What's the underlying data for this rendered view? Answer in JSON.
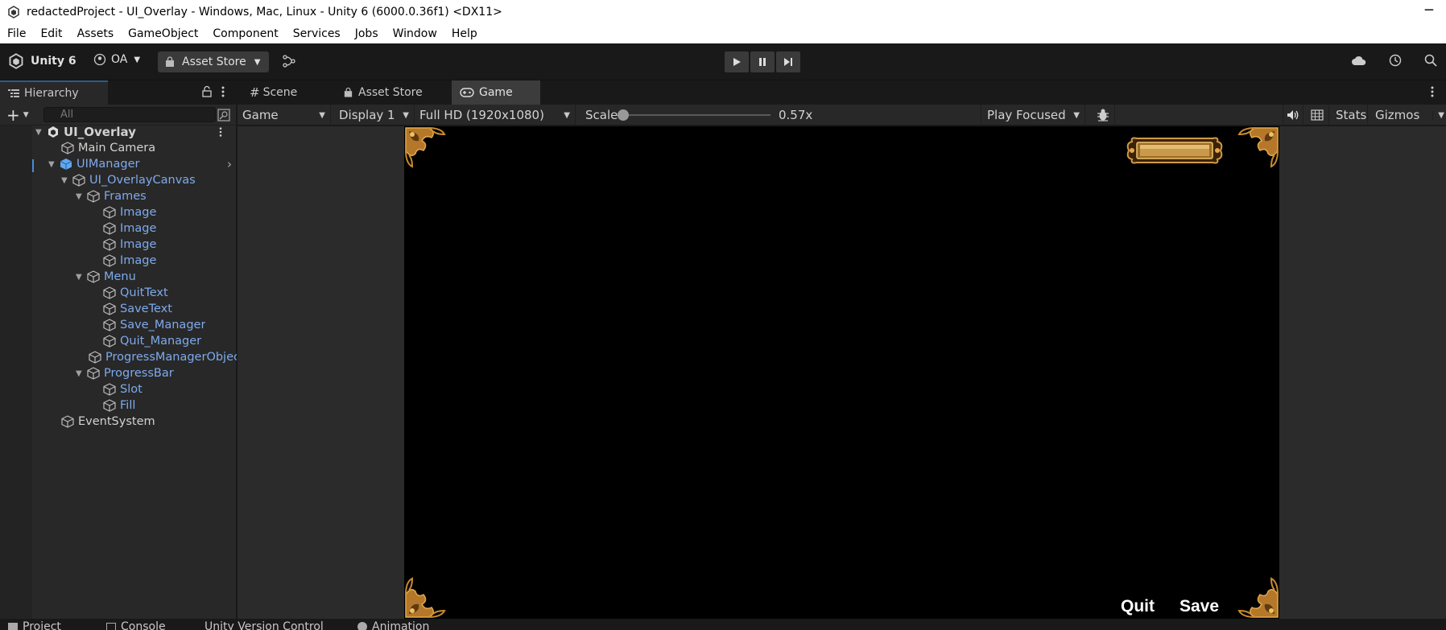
{
  "window": {
    "title": "redactedProject - UI_Overlay - Windows, Mac, Linux - Unity 6 (6000.0.36f1) <DX11>",
    "minimize": "─"
  },
  "menu": [
    "File",
    "Edit",
    "Assets",
    "GameObject",
    "Component",
    "Services",
    "Jobs",
    "Window",
    "Help"
  ],
  "toolbar": {
    "unity_label": "Unity 6",
    "account_label": "OA",
    "store_label": "Asset Store"
  },
  "tabs": {
    "hierarchy": "Hierarchy",
    "scene": "Scene",
    "asset_store": "Asset Store",
    "game": "Game"
  },
  "hierarchy": {
    "search_placeholder": "All",
    "items": [
      {
        "label": "UI_Overlay"
      },
      {
        "label": "Main Camera"
      },
      {
        "label": "UIManager"
      },
      {
        "label": "UI_OverlayCanvas"
      },
      {
        "label": "Frames"
      },
      {
        "label": "Image"
      },
      {
        "label": "Image"
      },
      {
        "label": "Image"
      },
      {
        "label": "Image"
      },
      {
        "label": "Menu"
      },
      {
        "label": "QuitText"
      },
      {
        "label": "SaveText"
      },
      {
        "label": "Save_Manager"
      },
      {
        "label": "Quit_Manager"
      },
      {
        "label": "ProgressManagerObject"
      },
      {
        "label": "ProgressBar"
      },
      {
        "label": "Slot"
      },
      {
        "label": "Fill"
      },
      {
        "label": "EventSystem"
      }
    ]
  },
  "game_controls": {
    "view": "Game",
    "display": "Display 1",
    "resolution": "Full HD (1920x1080)",
    "scale_label": "Scale",
    "scale_value": "0.57x",
    "play_mode": "Play Focused",
    "stats": "Stats",
    "gizmos": "Gizmos"
  },
  "game_view": {
    "quit_text": "Quit",
    "save_text": "Save"
  },
  "bottom_tabs": [
    "Project",
    "Console",
    "Unity Version Control",
    "Animation"
  ],
  "colors": {
    "accent": "#2c5d87",
    "hierarchy_blue": "#7eaaec",
    "frame_gold": "#c98a2e"
  }
}
